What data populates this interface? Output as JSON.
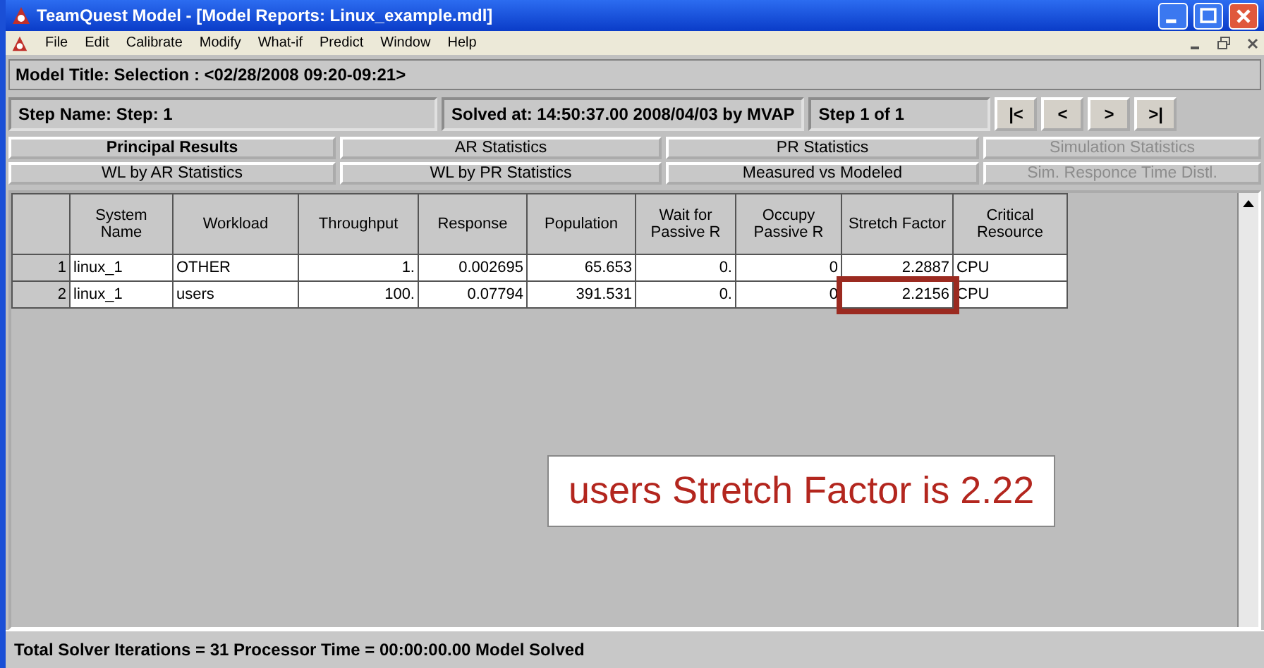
{
  "window": {
    "title": "TeamQuest Model - [Model Reports: Linux_example.mdl]"
  },
  "menu": [
    "File",
    "Edit",
    "Calibrate",
    "Modify",
    "What-if",
    "Predict",
    "Window",
    "Help"
  ],
  "model_title": "Model Title: Selection : <02/28/2008 09:20-09:21>",
  "step": {
    "name": "Step Name:  Step: 1",
    "solved": "Solved at: 14:50:37.00  2008/04/03 by MVAP",
    "position": "Step 1 of 1",
    "nav": [
      "|<",
      "<",
      ">",
      ">|"
    ]
  },
  "tabs": [
    {
      "label": "Principal Results",
      "selected": true,
      "disabled": false
    },
    {
      "label": "AR Statistics",
      "selected": false,
      "disabled": false
    },
    {
      "label": "PR Statistics",
      "selected": false,
      "disabled": false
    },
    {
      "label": "Simulation Statistics",
      "selected": false,
      "disabled": true
    },
    {
      "label": "WL by AR Statistics",
      "selected": false,
      "disabled": false
    },
    {
      "label": "WL by PR Statistics",
      "selected": false,
      "disabled": false
    },
    {
      "label": "Measured vs Modeled",
      "selected": false,
      "disabled": false
    },
    {
      "label": "Sim. Responce Time Distl.",
      "selected": false,
      "disabled": true
    }
  ],
  "table": {
    "columns": [
      "System Name",
      "Workload",
      "Throughput",
      "Response",
      "Population",
      "Wait for Passive R",
      "Occupy Passive R",
      "Stretch Factor",
      "Critical Resource"
    ],
    "rows": [
      {
        "number": "1",
        "cells": [
          "linux_1",
          "OTHER",
          "1.",
          "0.002695",
          "65.653",
          "0.",
          "0",
          "2.2887",
          "CPU"
        ],
        "outlined": false
      },
      {
        "number": "2",
        "cells": [
          "linux_1",
          "users",
          "100.",
          "0.07794",
          "391.531",
          "0.",
          "0",
          "2.2156",
          "CPU"
        ],
        "outlined": true
      }
    ]
  },
  "callout": "users Stretch Factor is 2.22",
  "status_bar": "Total Solver Iterations =  31  Processor Time = 00:00:00.00  Model Solved"
}
